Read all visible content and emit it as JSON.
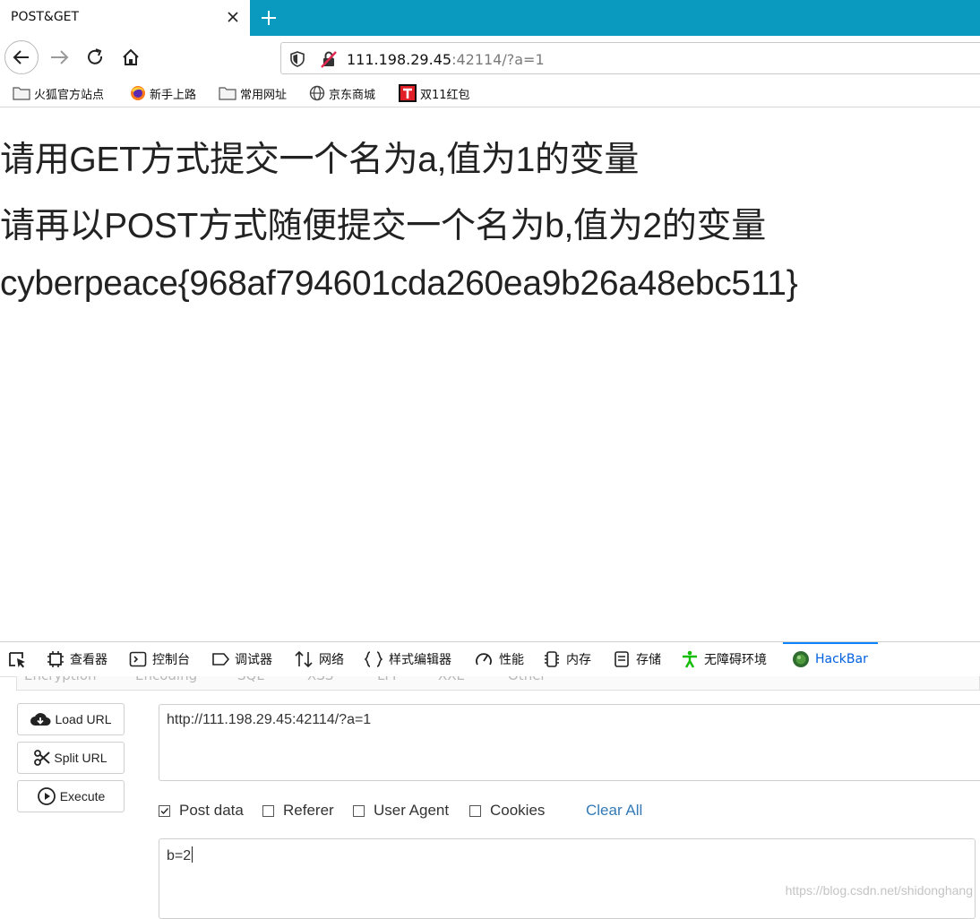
{
  "tab": {
    "title": "POST&GET"
  },
  "address_bar": {
    "host": "111.198.29.45",
    "rest": ":42114/?a=1"
  },
  "bookmarks": [
    {
      "label": "火狐官方站点",
      "icon": "folder-icon"
    },
    {
      "label": "新手上路",
      "icon": "firefox-icon"
    },
    {
      "label": "常用网址",
      "icon": "folder-icon"
    },
    {
      "label": "京东商城",
      "icon": "globe-icon"
    },
    {
      "label": "双11红包",
      "icon": "tmall-icon"
    }
  ],
  "page": {
    "lines": [
      "请用GET方式提交一个名为a,值为1的变量",
      "请再以POST方式随便提交一个名为b,值为2的变量",
      "cyberpeace{968af794601cda260ea9b26a48ebc511}"
    ]
  },
  "devtools": {
    "tabs": [
      {
        "label": "查看器",
        "icon": "inspector-icon"
      },
      {
        "label": "控制台",
        "icon": "console-icon"
      },
      {
        "label": "调试器",
        "icon": "debugger-icon"
      },
      {
        "label": "网络",
        "icon": "network-icon"
      },
      {
        "label": "样式编辑器",
        "icon": "braces-icon"
      },
      {
        "label": "性能",
        "icon": "gauge-icon"
      },
      {
        "label": "内存",
        "icon": "memory-icon"
      },
      {
        "label": "存储",
        "icon": "storage-icon"
      },
      {
        "label": "无障碍环境",
        "icon": "accessibility-icon"
      },
      {
        "label": "HackBar",
        "icon": "hackbar-icon"
      }
    ],
    "active_tab": "HackBar"
  },
  "hackbar": {
    "menu": [
      "Encryption",
      "Encoding",
      "SQL",
      "XSS",
      "LFI",
      "XXE",
      "Other"
    ],
    "buttons": {
      "load_url": "Load URL",
      "split_url": "Split URL",
      "execute": "Execute"
    },
    "url_value": "http://111.198.29.45:42114/?a=1",
    "options": [
      {
        "label": "Post data",
        "checked": true
      },
      {
        "label": "Referer",
        "checked": false
      },
      {
        "label": "User Agent",
        "checked": false
      },
      {
        "label": "Cookies",
        "checked": false
      }
    ],
    "clear_all": "Clear All",
    "post_value": "b=2"
  },
  "watermark": "https://blog.csdn.net/shidonghang",
  "colors": {
    "tab_strip": "#0a9ac0",
    "active_devtab": "#0060df",
    "link": "#337ab7"
  }
}
